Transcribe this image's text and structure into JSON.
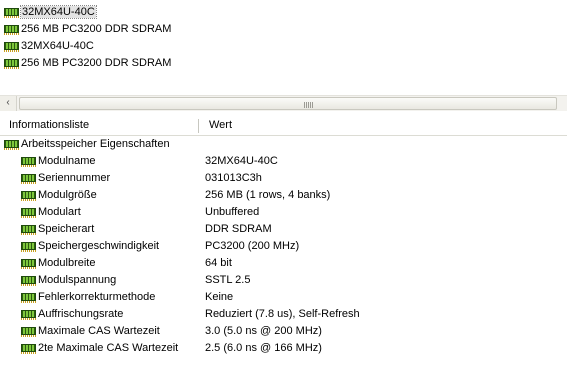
{
  "top_list": [
    {
      "label": "32MX64U-40C",
      "selected": true
    },
    {
      "label": "256 MB PC3200 DDR SDRAM",
      "selected": false
    },
    {
      "label": "32MX64U-40C",
      "selected": false
    },
    {
      "label": "256 MB PC3200 DDR SDRAM",
      "selected": false
    }
  ],
  "scrollbar": {
    "left_arrow": "‹",
    "grip": "|||"
  },
  "columns": {
    "name": "Informationsliste",
    "value": "Wert"
  },
  "group": {
    "label": "Arbeitsspeicher Eigenschaften",
    "icon": "memory-icon"
  },
  "rows": [
    {
      "name": "Modulname",
      "value": "32MX64U-40C"
    },
    {
      "name": "Seriennummer",
      "value": "031013C3h"
    },
    {
      "name": "Modulgröße",
      "value": "256 MB (1 rows, 4 banks)"
    },
    {
      "name": "Modulart",
      "value": "Unbuffered"
    },
    {
      "name": "Speicherart",
      "value": "DDR SDRAM"
    },
    {
      "name": "Speichergeschwindigkeit",
      "value": "PC3200 (200 MHz)"
    },
    {
      "name": "Modulbreite",
      "value": "64 bit"
    },
    {
      "name": "Modulspannung",
      "value": "SSTL 2.5"
    },
    {
      "name": "Fehlerkorrekturmethode",
      "value": "Keine"
    },
    {
      "name": "Auffrischungsrate",
      "value": "Reduziert (7.8 us), Self-Refresh"
    },
    {
      "name": "Maximale CAS Wartezeit",
      "value": "3.0 (5.0 ns @ 200 MHz)"
    },
    {
      "name": "2te Maximale CAS Wartezeit",
      "value": "2.5 (6.0 ns @ 166 MHz)"
    }
  ]
}
